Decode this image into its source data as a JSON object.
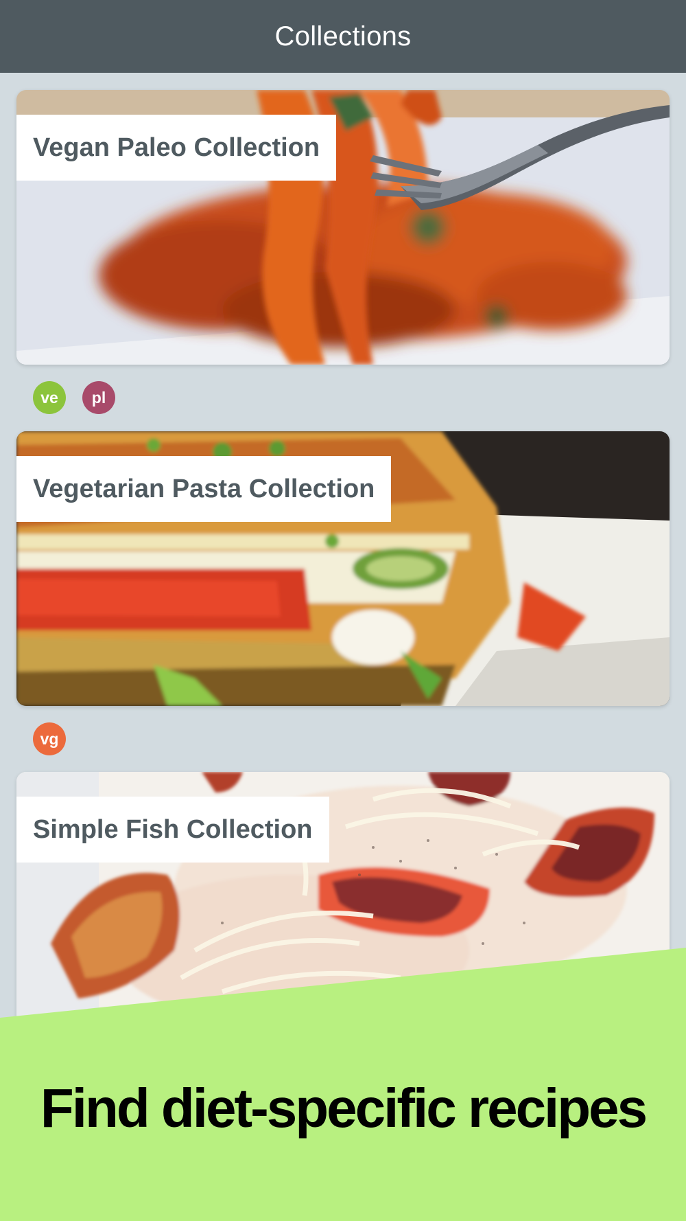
{
  "header": {
    "title": "Collections"
  },
  "collections": [
    {
      "title": "Vegan Paleo Collection",
      "image": "carrot-noodles-with-fork",
      "badges": [
        {
          "label": "ve",
          "color": "#8cc43c"
        },
        {
          "label": "pl",
          "color": "#a84a6a"
        }
      ]
    },
    {
      "title": "Vegetarian Pasta Collection",
      "image": "vegetable-lasagna",
      "badges": [
        {
          "label": "vg",
          "color": "#ec6a3c"
        }
      ]
    },
    {
      "title": "Simple Fish Collection",
      "image": "fish-carpaccio-with-blood-orange",
      "badges": []
    }
  ],
  "promo": {
    "text": "Find diet-specific recipes",
    "color": "#b8f080"
  }
}
